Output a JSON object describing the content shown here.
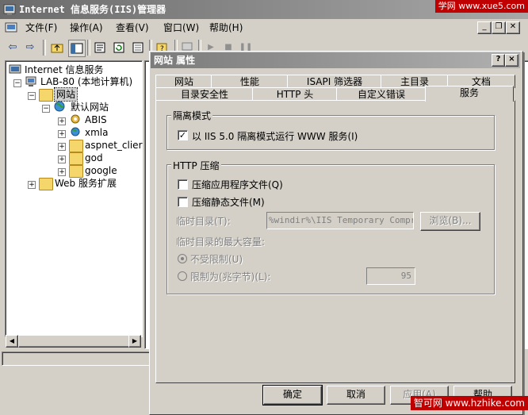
{
  "main_window": {
    "title": "Internet 信息服务(IIS)管理器",
    "icon": "iis-app-icon"
  },
  "watermarks": {
    "top": "学网 www.xue5.com",
    "bottom": "智可网 www.hzhike.com"
  },
  "menu": [
    {
      "label": "文件(F)"
    },
    {
      "label": "操作(A)"
    },
    {
      "label": "查看(V)"
    },
    {
      "label": "窗口(W)"
    },
    {
      "label": "帮助(H)"
    }
  ],
  "mdi_controls": [
    "minimize-icon",
    "restore-icon",
    "close-icon"
  ],
  "toolbar_icons": [
    "back-arrow-icon",
    "forward-arrow-icon",
    "up-folder-icon",
    "show-hide-tree-icon",
    "properties-icon",
    "refresh-icon",
    "export-list-icon",
    "help-icon",
    "connect-icon",
    "computer-icon",
    "play-icon",
    "stop-icon",
    "pause-icon"
  ],
  "tree": {
    "root": "Internet 信息服务",
    "computer": "LAB-80 (本地计算机)",
    "websites": "网站",
    "default_site": "默认网站",
    "children": [
      "ABIS",
      "xmla",
      "aspnet_clier",
      "god",
      "google"
    ],
    "web_ext": "Web 服务扩展"
  },
  "dialog": {
    "title": "网站 属性",
    "help_btn": "?",
    "close_btn": "×",
    "tabs_row1": [
      "网站",
      "性能",
      "ISAPI 筛选器",
      "主目录",
      "文档"
    ],
    "tabs_row2": [
      "目录安全性",
      "HTTP 头",
      "自定义错误",
      "服务"
    ],
    "active_tab": "服务",
    "isolation_group": "隔离模式",
    "isolation_checkbox": "以 IIS 5.0 隔离模式运行 WWW 服务(I)",
    "isolation_checked": true,
    "compression_group": "HTTP 压缩",
    "compress_app_files": "压缩应用程序文件(Q)",
    "compress_app_checked": false,
    "compress_static_files": "压缩静态文件(M)",
    "compress_static_checked": false,
    "temp_dir_label": "临时目录(T):",
    "temp_dir_value": "%windir%\\IIS Temporary Compres",
    "browse_btn": "浏览(B)...",
    "max_size_label": "临时目录的最大容量:",
    "unlimited_radio": "不受限制(U)",
    "limit_radio": "限制为(兆字节)(L):",
    "limit_value": "95",
    "ok_btn": "确定",
    "cancel_btn": "取消",
    "apply_btn": "应用(A)",
    "help_footer_btn": "帮助"
  }
}
